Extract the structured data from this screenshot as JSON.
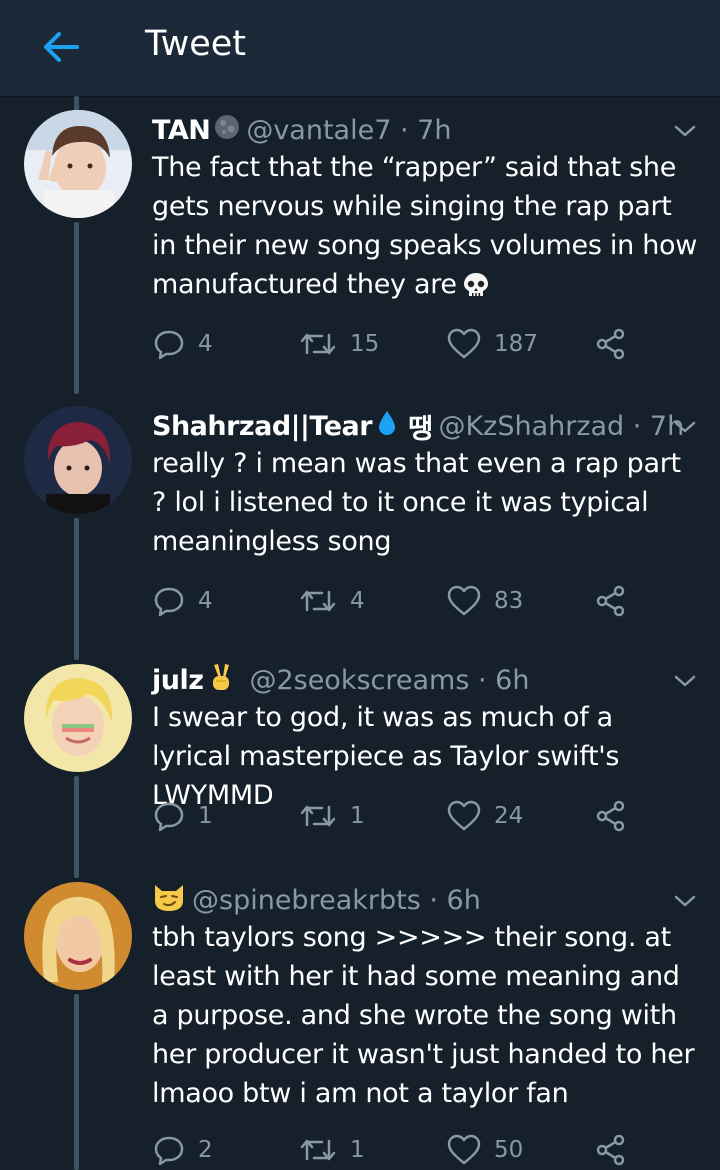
{
  "header": {
    "title": "Tweet",
    "back_icon": "arrow-left-icon",
    "accent": "#1da1f2"
  },
  "colors": {
    "background": "#15202b",
    "header_background": "#1c2938",
    "muted": "#8899a6",
    "thread_line": "#3d5466"
  },
  "tweets": [
    {
      "name": "TAN",
      "name_emoji": "moon-icon",
      "handle": "@vantale7 · 7h",
      "text": "The fact that the “rapper” said that she gets nervous while singing the rap part in their new song speaks volumes in how manufactured they are",
      "text_emoji": "skull-icon",
      "replies": "4",
      "retweets": "15",
      "likes": "187"
    },
    {
      "name": "Shahrzad||Tear",
      "name_emoji": "droplet-icon",
      "name_suffix": "땡",
      "handle": "@KzShahrzad · 7h",
      "text": "really ? i mean was that even a rap part ? lol i listened to it once it was typical meaningless song",
      "replies": "4",
      "retweets": "4",
      "likes": "83"
    },
    {
      "name": "julz",
      "name_emoji": "victory-hand-icon",
      "handle": "@2seokscreams · 6h",
      "text": "I swear to god, it was as much of a lyrical masterpiece as Taylor swift's LWYMMD",
      "replies": "1",
      "retweets": "1",
      "likes": "24"
    },
    {
      "name": "",
      "name_emoji": "smirking-cat-icon",
      "handle": "@spinebreakrbts · 6h",
      "text": "tbh taylors song >>>>> their song. at least with her it had some meaning and a purpose. and she wrote the song with her producer it wasn't just handed to her lmaoo btw i am not a taylor fan",
      "replies": "2",
      "retweets": "1",
      "likes": "50"
    }
  ]
}
